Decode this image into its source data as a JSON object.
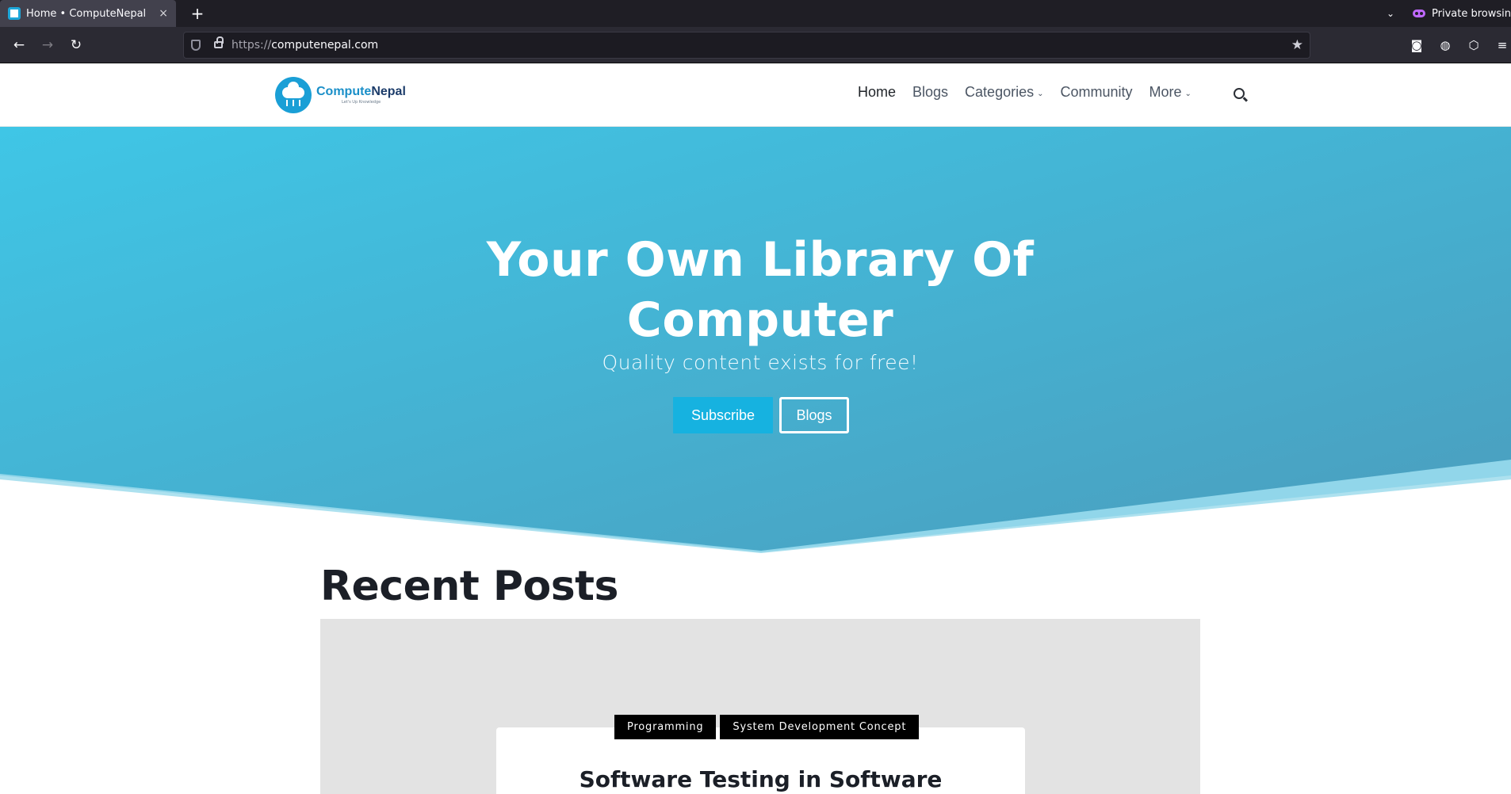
{
  "browser": {
    "tab_title": "Home • ComputeNepal",
    "tab_close": "×",
    "new_tab": "+",
    "tab_list": "⌄",
    "private_label": "Private browsing",
    "back": "←",
    "forward": "→",
    "reload": "↻",
    "url_protocol": "https://",
    "url_host": "computenepal.com",
    "bookmark_star": "★",
    "pocket": "◙",
    "account": "◍",
    "extensions": "⬡",
    "menu": "≡"
  },
  "site": {
    "logo": {
      "name_first": "Compute",
      "name_second": "Nepal",
      "tagline": "Let's Up Knowledge"
    },
    "nav": {
      "home": "Home",
      "blogs": "Blogs",
      "categories": "Categories",
      "community": "Community",
      "more": "More",
      "dropdown_glyph": "⌄"
    }
  },
  "hero": {
    "title": "Your Own Library Of Computer",
    "subtitle": "Quality content exists for free!",
    "subscribe_label": "Subscribe",
    "blogs_label": "Blogs",
    "gradient_start": "#3fc6e6",
    "gradient_end": "#4b9dbd"
  },
  "recent": {
    "heading": "Recent Posts",
    "posts": [
      {
        "tags": [
          "Programming",
          "System Development Concept"
        ],
        "title": "Software Testing in Software"
      }
    ]
  }
}
